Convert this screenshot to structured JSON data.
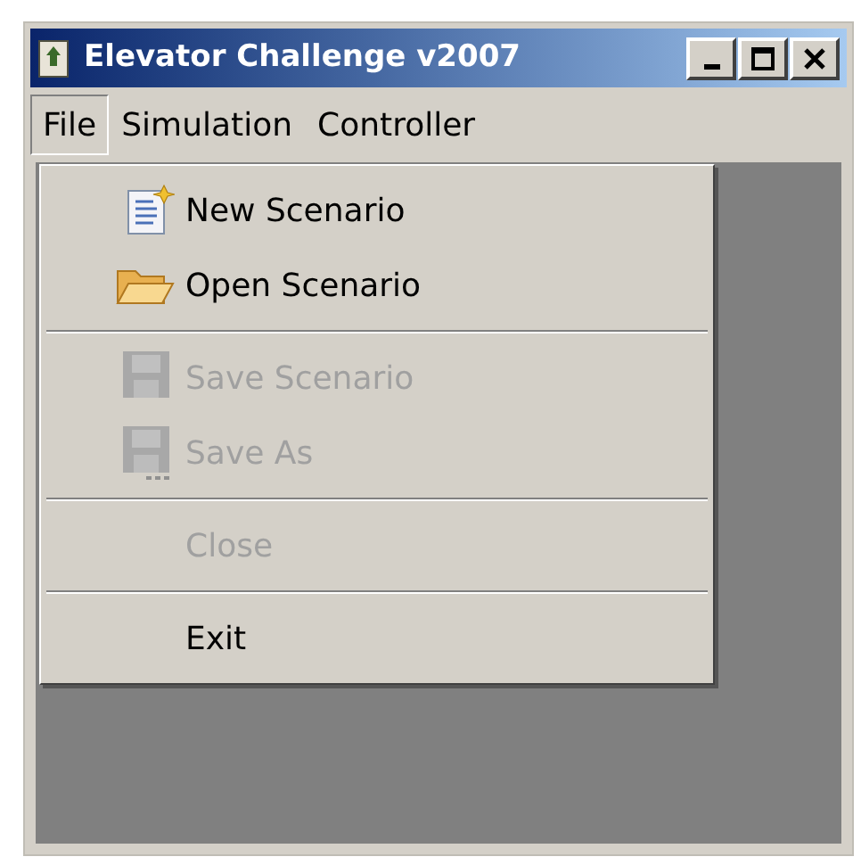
{
  "window": {
    "title": "Elevator Challenge v2007"
  },
  "menubar": [
    {
      "label": "File",
      "selected": true
    },
    {
      "label": "Simulation",
      "selected": false
    },
    {
      "label": "Controller",
      "selected": false
    }
  ],
  "file_menu": [
    {
      "kind": "new",
      "label": "New Scenario",
      "disabled": false
    },
    {
      "kind": "open",
      "label": "Open Scenario",
      "disabled": false
    },
    {
      "kind": "separator"
    },
    {
      "kind": "save",
      "label": "Save Scenario",
      "disabled": true
    },
    {
      "kind": "saveas",
      "label": "Save As",
      "disabled": true
    },
    {
      "kind": "separator"
    },
    {
      "kind": "plain",
      "label": "Close",
      "disabled": true
    },
    {
      "kind": "separator"
    },
    {
      "kind": "plain",
      "label": "Exit",
      "disabled": false
    }
  ]
}
